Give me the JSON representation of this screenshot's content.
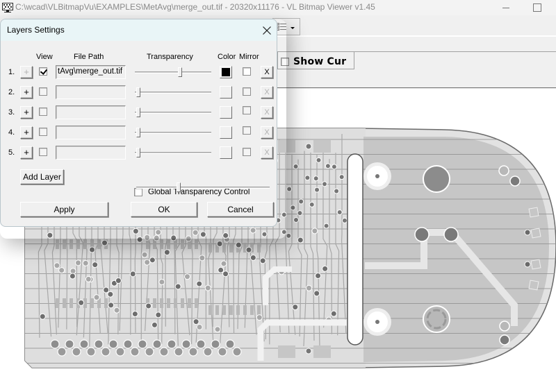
{
  "window": {
    "title": "C:\\wcad\\VLBitmapVu\\EXAMPLES\\MetAvg\\merge_out.tif - 20320x11176 - VL Bitmap Viewer v1.45",
    "icon": "monitor-grid-icon",
    "controls": {
      "minimize": "minimize-icon",
      "maximize": "maximize-icon"
    }
  },
  "toolbar": {
    "view_mode_icon": "list-grid-icon",
    "show_cursor_label": "Show Cur",
    "show_cursor_checked": false
  },
  "dialog": {
    "title": "Layers Settings",
    "close_icon": "close-icon",
    "columns": {
      "view": "View",
      "file_path": "File Path",
      "transparency": "Transparency",
      "color": "Color",
      "mirror": "Mirror"
    },
    "layers": [
      {
        "num": "1.",
        "add_label": "+",
        "add_enabled": false,
        "view": true,
        "path": "tAvg\\merge_out.tif",
        "transparency": 0.6,
        "color": "#000000",
        "mirror": false,
        "remove_label": "X",
        "remove_enabled": true
      },
      {
        "num": "2.",
        "add_label": "+",
        "add_enabled": true,
        "view": false,
        "path": "",
        "transparency": 0.0,
        "color": "",
        "mirror": false,
        "remove_label": "X",
        "remove_enabled": false
      },
      {
        "num": "3.",
        "add_label": "+",
        "add_enabled": true,
        "view": false,
        "path": "",
        "transparency": 0.0,
        "color": "",
        "mirror": false,
        "remove_label": "X",
        "remove_enabled": false
      },
      {
        "num": "4.",
        "add_label": "+",
        "add_enabled": true,
        "view": false,
        "path": "",
        "transparency": 0.0,
        "color": "",
        "mirror": false,
        "remove_label": "X",
        "remove_enabled": false
      },
      {
        "num": "5.",
        "add_label": "+",
        "add_enabled": true,
        "view": false,
        "path": "",
        "transparency": 0.0,
        "color": "",
        "mirror": false,
        "remove_label": "X",
        "remove_enabled": false
      }
    ],
    "add_layer_label": "Add Layer",
    "global_transparency_label": "Global Transparency Control",
    "global_transparency_checked": false,
    "global_transparency_value": 0.3,
    "buttons": {
      "apply": "Apply",
      "ok": "OK",
      "cancel": "Cancel"
    }
  },
  "canvas": {
    "content": "pcb-board-image"
  }
}
